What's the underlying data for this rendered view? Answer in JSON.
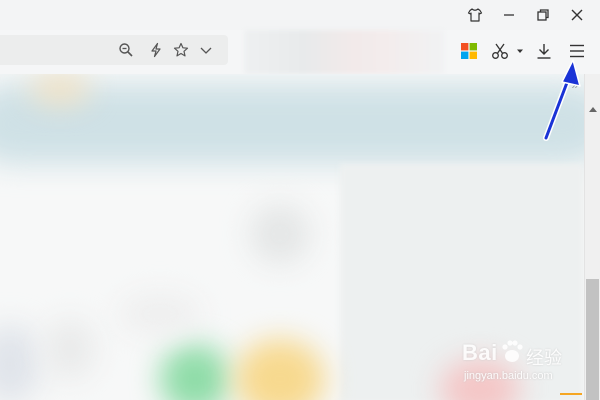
{
  "window": {
    "controls": [
      "skin-icon",
      "minimize-icon",
      "restore-icon",
      "close-icon"
    ]
  },
  "addressbar": {
    "icons": [
      "zoom-icon",
      "lightning-icon",
      "star-icon",
      "chevron-down-icon"
    ]
  },
  "toolbar": {
    "icons": [
      "apps-grid-icon",
      "scissors-icon",
      "dropdown-caret-icon",
      "download-icon",
      "menu-icon"
    ],
    "apps_colors": [
      "#f25022",
      "#7fba00",
      "#00a4ef",
      "#ffb900"
    ]
  },
  "bookmarks": {
    "overflow_label": "»"
  },
  "annotation": {
    "arrow_color": "#1a33d6",
    "points_to": "menu-icon"
  },
  "watermark": {
    "brand": "Bai",
    "brand_cn": "经验",
    "url": "jingyan.baidu.com"
  }
}
